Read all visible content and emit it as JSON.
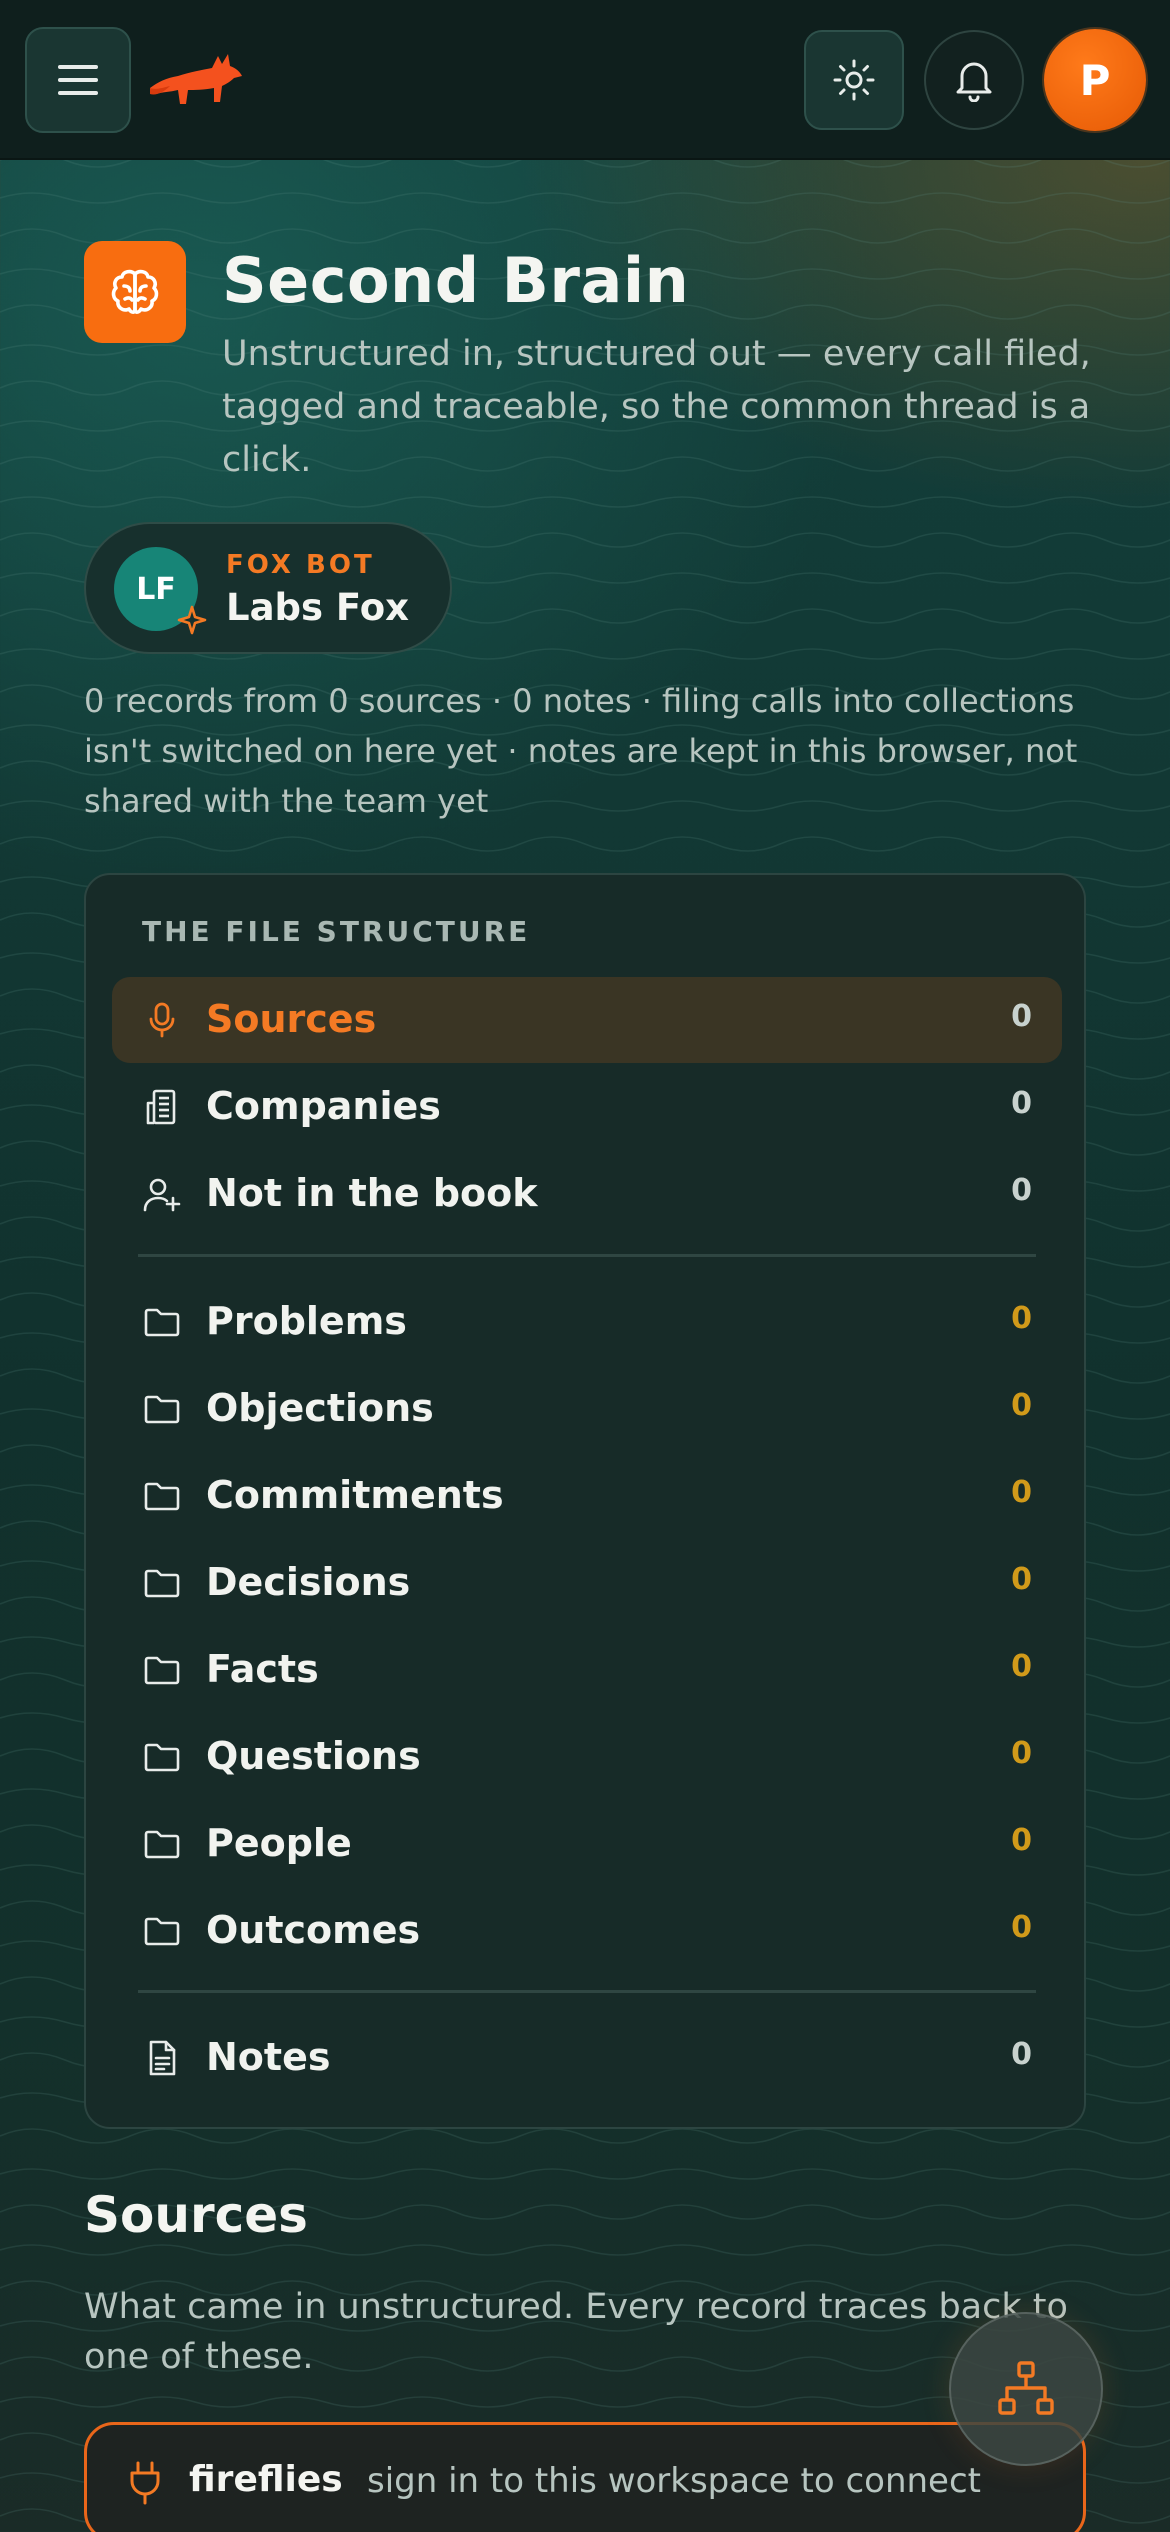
{
  "header": {
    "menu_icon": "hamburger-menu-icon",
    "logo_icon": "fox-logo-icon",
    "theme_icon": "sun-icon",
    "notifications_icon": "bell-icon",
    "user_initial": "P"
  },
  "hero": {
    "icon": "brain-icon",
    "title": "Second Brain",
    "subtitle": "Unstructured in, structured out — every call filed, tagged and traceable, so the common thread is a click."
  },
  "bot": {
    "initials": "LF",
    "role": "FOX BOT",
    "name": "Labs Fox"
  },
  "stats": "0 records from 0 sources · 0 notes · filing calls into collections isn't switched on here yet · notes are kept in this browser, not shared with the team yet",
  "file_structure": {
    "title": "THE FILE STRUCTURE",
    "primary": [
      {
        "label": "Sources",
        "count": "0",
        "icon": "microphone-icon",
        "active": true
      },
      {
        "label": "Companies",
        "count": "0",
        "icon": "building-icon"
      },
      {
        "label": "Not in the book",
        "count": "0",
        "icon": "user-plus-icon"
      }
    ],
    "collections": [
      {
        "label": "Problems",
        "count": "0",
        "icon": "folder-icon"
      },
      {
        "label": "Objections",
        "count": "0",
        "icon": "folder-icon"
      },
      {
        "label": "Commitments",
        "count": "0",
        "icon": "folder-icon"
      },
      {
        "label": "Decisions",
        "count": "0",
        "icon": "folder-icon"
      },
      {
        "label": "Facts",
        "count": "0",
        "icon": "folder-icon"
      },
      {
        "label": "Questions",
        "count": "0",
        "icon": "folder-icon"
      },
      {
        "label": "People",
        "count": "0",
        "icon": "folder-icon"
      },
      {
        "label": "Outcomes",
        "count": "0",
        "icon": "folder-icon"
      }
    ],
    "notes": {
      "label": "Notes",
      "count": "0",
      "icon": "document-icon"
    }
  },
  "sources_section": {
    "title": "Sources",
    "description": "What came in unstructured. Every record traces back to one of these.",
    "items": [
      {
        "name": "fireflies",
        "hint": "sign in to this workspace to connect",
        "icon": "plug-icon"
      }
    ]
  },
  "fab_icon": "hierarchy-icon",
  "colors": {
    "accent": "#f86d10",
    "accent_text": "#f47a24",
    "teal": "#178577",
    "count_amber": "#d19a1a",
    "card_bg": "#172b28"
  }
}
